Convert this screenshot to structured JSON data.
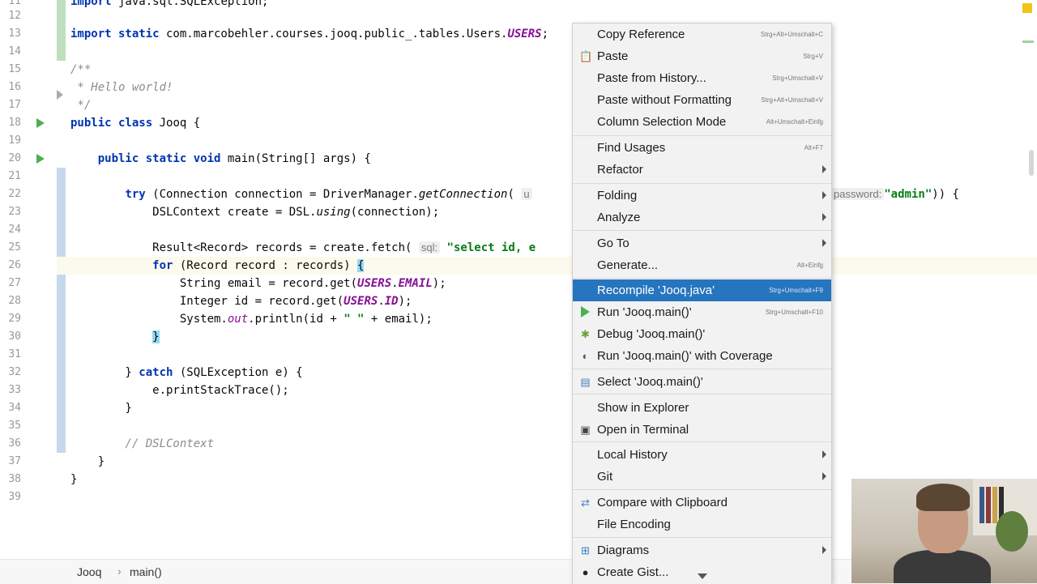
{
  "editor": {
    "lines": [
      {
        "n": "11",
        "code": "import java.sql.SQLException;"
      },
      {
        "n": "12",
        "code": ""
      },
      {
        "n": "13",
        "code": "import static com.marcobehler.courses.jooq.public_.tables.Users.USERS;"
      },
      {
        "n": "14",
        "code": ""
      },
      {
        "n": "15",
        "code": "/**"
      },
      {
        "n": "16",
        "code": " * Hello world!"
      },
      {
        "n": "17",
        "code": " */"
      },
      {
        "n": "18",
        "code": "public class Jooq {"
      },
      {
        "n": "19",
        "code": ""
      },
      {
        "n": "20",
        "code": "    public static void main(String[] args) {"
      },
      {
        "n": "21",
        "code": ""
      },
      {
        "n": "22",
        "code": "        try (Connection connection = DriverManager.getConnection( u"
      },
      {
        "n": "23",
        "code": "            DSLContext create = DSL.using(connection);"
      },
      {
        "n": "24",
        "code": ""
      },
      {
        "n": "25",
        "code": "            Result<Record> records = create.fetch( sql: \"select id, e"
      },
      {
        "n": "26",
        "code": "            for (Record record : records) {"
      },
      {
        "n": "27",
        "code": "                String email = record.get(USERS.EMAIL);"
      },
      {
        "n": "28",
        "code": "                Integer id = record.get(USERS.ID);"
      },
      {
        "n": "29",
        "code": "                System.out.println(id + \" \" + email);"
      },
      {
        "n": "30",
        "code": "            }"
      },
      {
        "n": "31",
        "code": ""
      },
      {
        "n": "32",
        "code": "        } catch (SQLException e) {"
      },
      {
        "n": "33",
        "code": "            e.printStackTrace();"
      },
      {
        "n": "34",
        "code": "        }"
      },
      {
        "n": "35",
        "code": ""
      },
      {
        "n": "36",
        "code": "        // DSLContext"
      },
      {
        "n": "37",
        "code": "    }"
      },
      {
        "n": "38",
        "code": "}"
      },
      {
        "n": "39",
        "code": ""
      }
    ],
    "line22_tail": {
      "hint": "password:",
      "value": "\"admin\"",
      "rest": ")) {"
    }
  },
  "breadcrumb": {
    "items": [
      "Jooq",
      "main()"
    ]
  },
  "context_menu": {
    "items": [
      {
        "label": "Copy Reference",
        "shortcut": "Strg+Alt+Umschalt+C"
      },
      {
        "label": "Paste",
        "shortcut": "Strg+V",
        "icon": "clipboard-icon"
      },
      {
        "label": "Paste from History...",
        "shortcut": "Strg+Umschalt+V"
      },
      {
        "label": "Paste without Formatting",
        "shortcut": "Strg+Alt+Umschalt+V"
      },
      {
        "label": "Column Selection Mode",
        "shortcut": "Alt+Umschalt+Einfg"
      },
      {
        "label": "Find Usages",
        "shortcut": "Alt+F7"
      },
      {
        "label": "Refactor",
        "submenu": true
      },
      {
        "label": "Folding",
        "submenu": true
      },
      {
        "label": "Analyze",
        "submenu": true
      },
      {
        "label": "Go To",
        "submenu": true
      },
      {
        "label": "Generate...",
        "shortcut": "Alt+Einfg"
      },
      {
        "label": "Recompile 'Jooq.java'",
        "shortcut": "Strg+Umschalt+F9",
        "selected": true
      },
      {
        "label": "Run 'Jooq.main()'",
        "shortcut": "Strg+Umschalt+F10",
        "icon": "run-icon"
      },
      {
        "label": "Debug 'Jooq.main()'",
        "icon": "debug-icon"
      },
      {
        "label": "Run 'Jooq.main()' with Coverage",
        "icon": "coverage-icon"
      },
      {
        "label": "Select 'Jooq.main()'",
        "icon": "select-target-icon"
      },
      {
        "label": "Show in Explorer"
      },
      {
        "label": "Open in Terminal",
        "icon": "terminal-icon"
      },
      {
        "label": "Local History",
        "submenu": true
      },
      {
        "label": "Git",
        "submenu": true
      },
      {
        "label": "Compare with Clipboard",
        "icon": "compare-icon"
      },
      {
        "label": "File Encoding"
      },
      {
        "label": "Diagrams",
        "submenu": true,
        "icon": "diagram-icon"
      },
      {
        "label": "Create Gist...",
        "icon": "github-icon"
      }
    ]
  },
  "colors": {
    "selection": "#2675bf",
    "run_green": "#4caf50",
    "vcs_added": "#bfe0bf"
  }
}
